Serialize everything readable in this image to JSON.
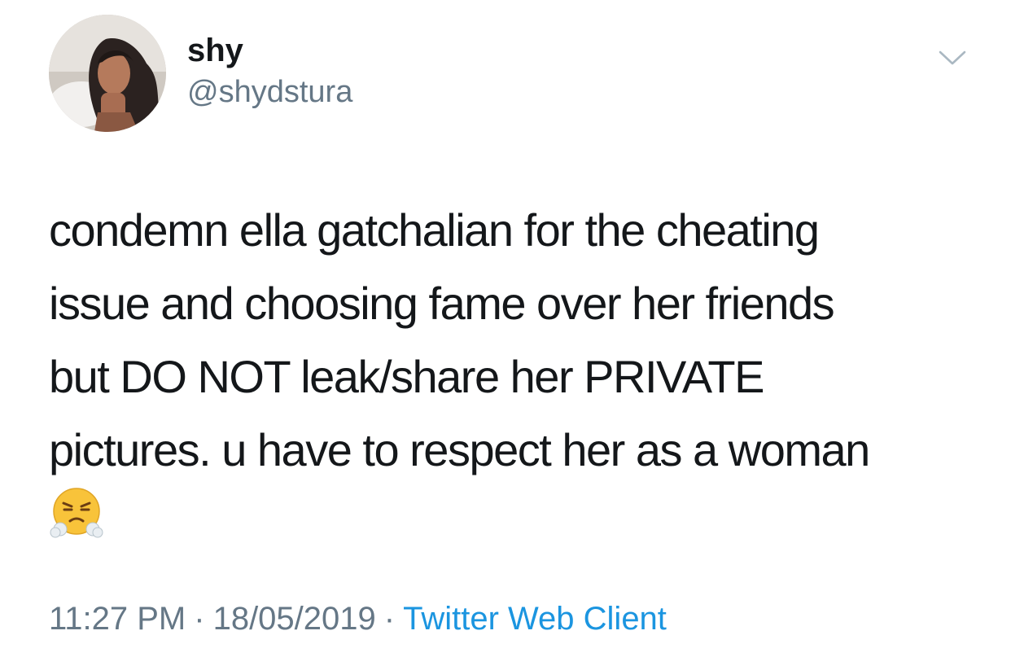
{
  "tweet": {
    "display_name": "shy",
    "handle": "@shydstura",
    "text": "condemn ella gatchalian for the cheating\nissue and choosing fame over her friends\nbut DO NOT leak/share her PRIVATE\npictures. u have to respect her as a woman",
    "emoji_icon": "face-with-steam-from-nose-emoji",
    "time": "11:27 PM",
    "separator": "·",
    "date": "18/05/2019",
    "source": "Twitter Web Client"
  },
  "colors": {
    "text": "#14171a",
    "secondary": "#657786",
    "link": "#1b95e0",
    "chevron": "#aab8c2"
  }
}
